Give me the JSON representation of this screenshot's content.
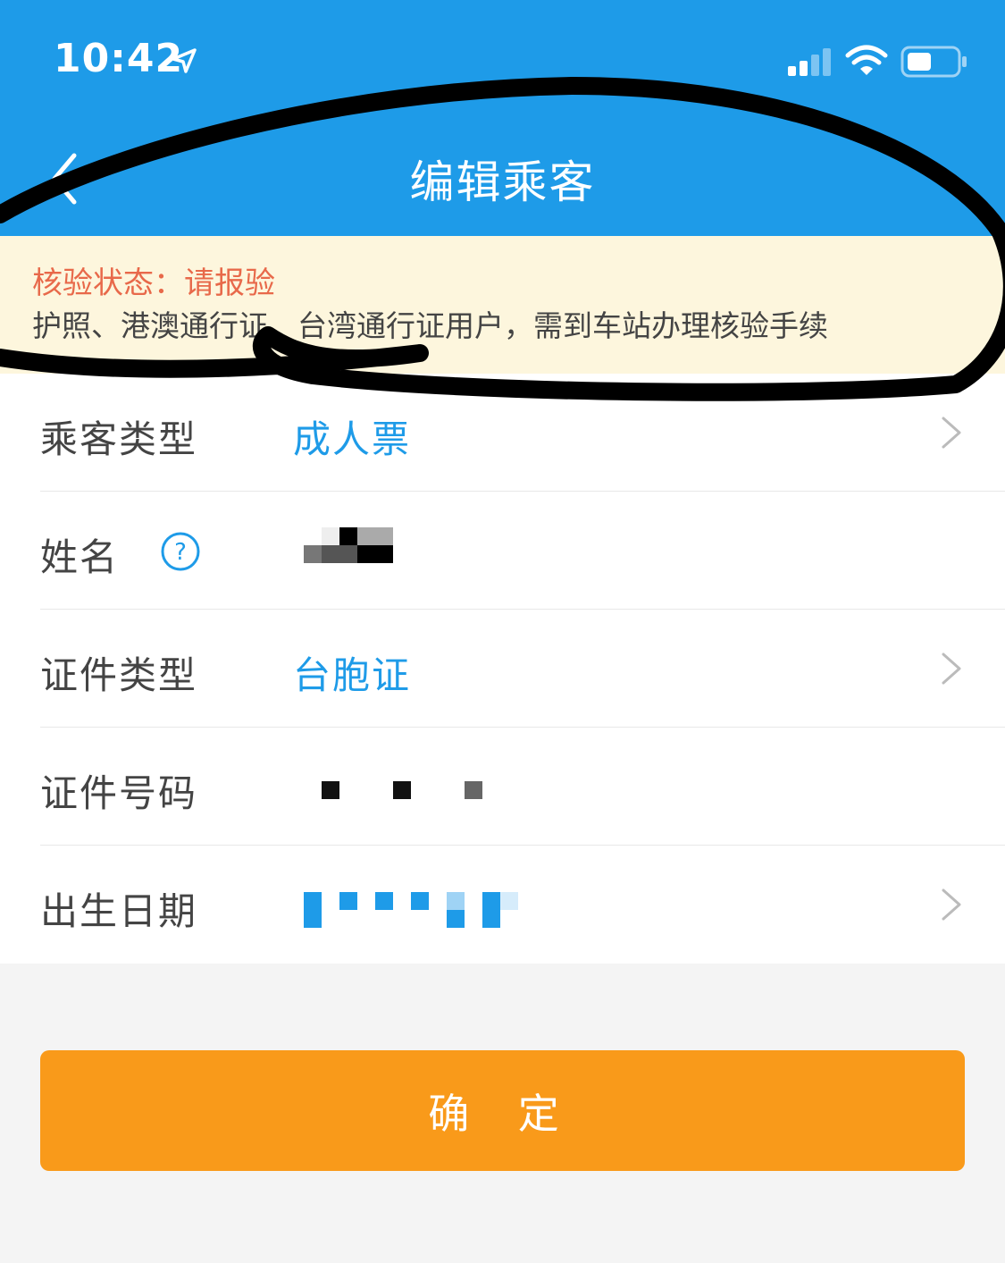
{
  "status_bar": {
    "time": "10:42",
    "icons": [
      "location-arrow-icon",
      "cellular-signal-icon",
      "wifi-icon",
      "battery-icon"
    ]
  },
  "nav": {
    "title": "编辑乘客",
    "back_icon": "chevron-left-icon"
  },
  "notice": {
    "status": "核验状态：请报验",
    "description": "护照、港澳通行证、台湾通行证用户，需到车站办理核验手续"
  },
  "form": {
    "passenger_type": {
      "label": "乘客类型",
      "value": "成人票"
    },
    "name": {
      "label": "姓名",
      "help_icon": "question-circle-icon"
    },
    "id_type": {
      "label": "证件类型",
      "value": "台胞证"
    },
    "id_number": {
      "label": "证件号码"
    },
    "birth_date": {
      "label": "出生日期"
    }
  },
  "confirm_button": {
    "label": "确 定"
  },
  "colors": {
    "brand": "#1e9be8",
    "accent": "#f99a1a",
    "notice_bg": "#fdf6dd",
    "notice_status": "#e8694a"
  }
}
